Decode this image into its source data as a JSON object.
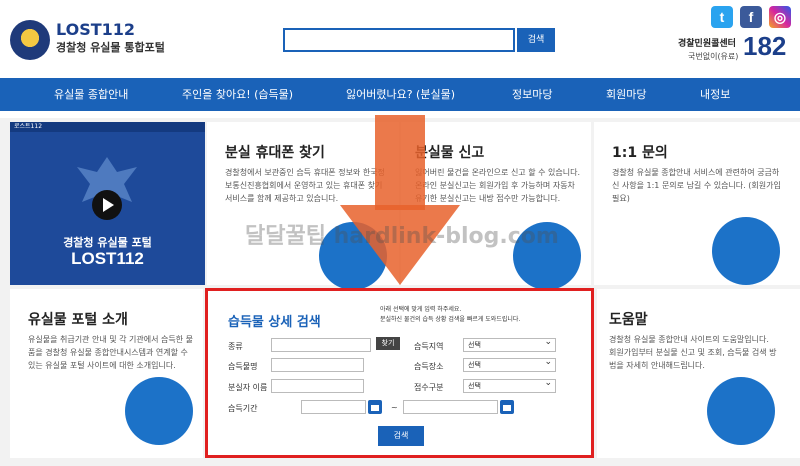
{
  "header": {
    "logo_title": "LOST112",
    "logo_sub": "경찰청 유실물 통합포털",
    "search_button": "검색",
    "sns": {
      "twitter": "t",
      "facebook": "f",
      "instagram": "◎"
    },
    "callcenter_label": "경찰민원콜센터",
    "callcenter_note": "국번없이(유료)",
    "callcenter_number": "182"
  },
  "nav": {
    "items": [
      "유실물 종합안내",
      "주인을 찾아요! (습득물)",
      "잃어버렸나요? (분실물)",
      "정보마당",
      "회원마당",
      "내정보"
    ]
  },
  "banner": {
    "top_label": "로스트112",
    "line1": "경찰청 유실물 포털",
    "line2": "LOST112"
  },
  "cards": {
    "phone": {
      "title": "분실 휴대폰 찾기",
      "text": "경찰청에서 보관중인 습득 휴대폰 정보와 한국정보통신진흥협회에서 운영하고 있는 휴대폰 찾기 서비스를 함께 제공하고 있습니다."
    },
    "report": {
      "title": "분실물 신고",
      "text": "잃어버린 물건을 온라인으로 신고 할 수 있습니다. 온라인 분실신고는 회원가입 후 가능하며 자동차 유기한 분실신고는 내방 접수만 가능합니다."
    },
    "qna": {
      "title": "1:1 문의",
      "text": "경찰청 유실물 종합안내 서비스에 관련하여 궁금하신 사항을 1:1 문의로 남길 수 있습니다. (회원가입 필요)"
    },
    "intro": {
      "title": "유실물 포털 소개",
      "text": "유실물을 취급기관 안내 및 각 기관에서 습득한 물품을 경찰청 유실물 종합안내시스템과 연계할 수 있는 유실물 포털 사이트에 대한 소개입니다."
    },
    "help": {
      "title": "도움말",
      "text": "경찰청 유실물 종합안내 사이트의 도움말입니다. 회원가입부터 분실물 신고 및 조회, 습득물 검색 방법을 자세히 안내해드립니다."
    }
  },
  "search_panel": {
    "title": "습득물 상세 검색",
    "desc": "아래 선택에 맞게 입력 하주세요.\n분실하신 물건의 습득 상황 검색을 빠르게 도와드립니다.",
    "labels": {
      "category": "종류",
      "item_name": "습득물명",
      "owner_name": "분실자 이름",
      "period": "습득기간",
      "region": "습득지역",
      "place": "습득장소",
      "receipt_type": "접수구분"
    },
    "find_button": "찾기",
    "select_default": "선택",
    "tilde": "~",
    "submit": "검색"
  },
  "watermark": "달달꿀팁 hardlink-blog.com"
}
